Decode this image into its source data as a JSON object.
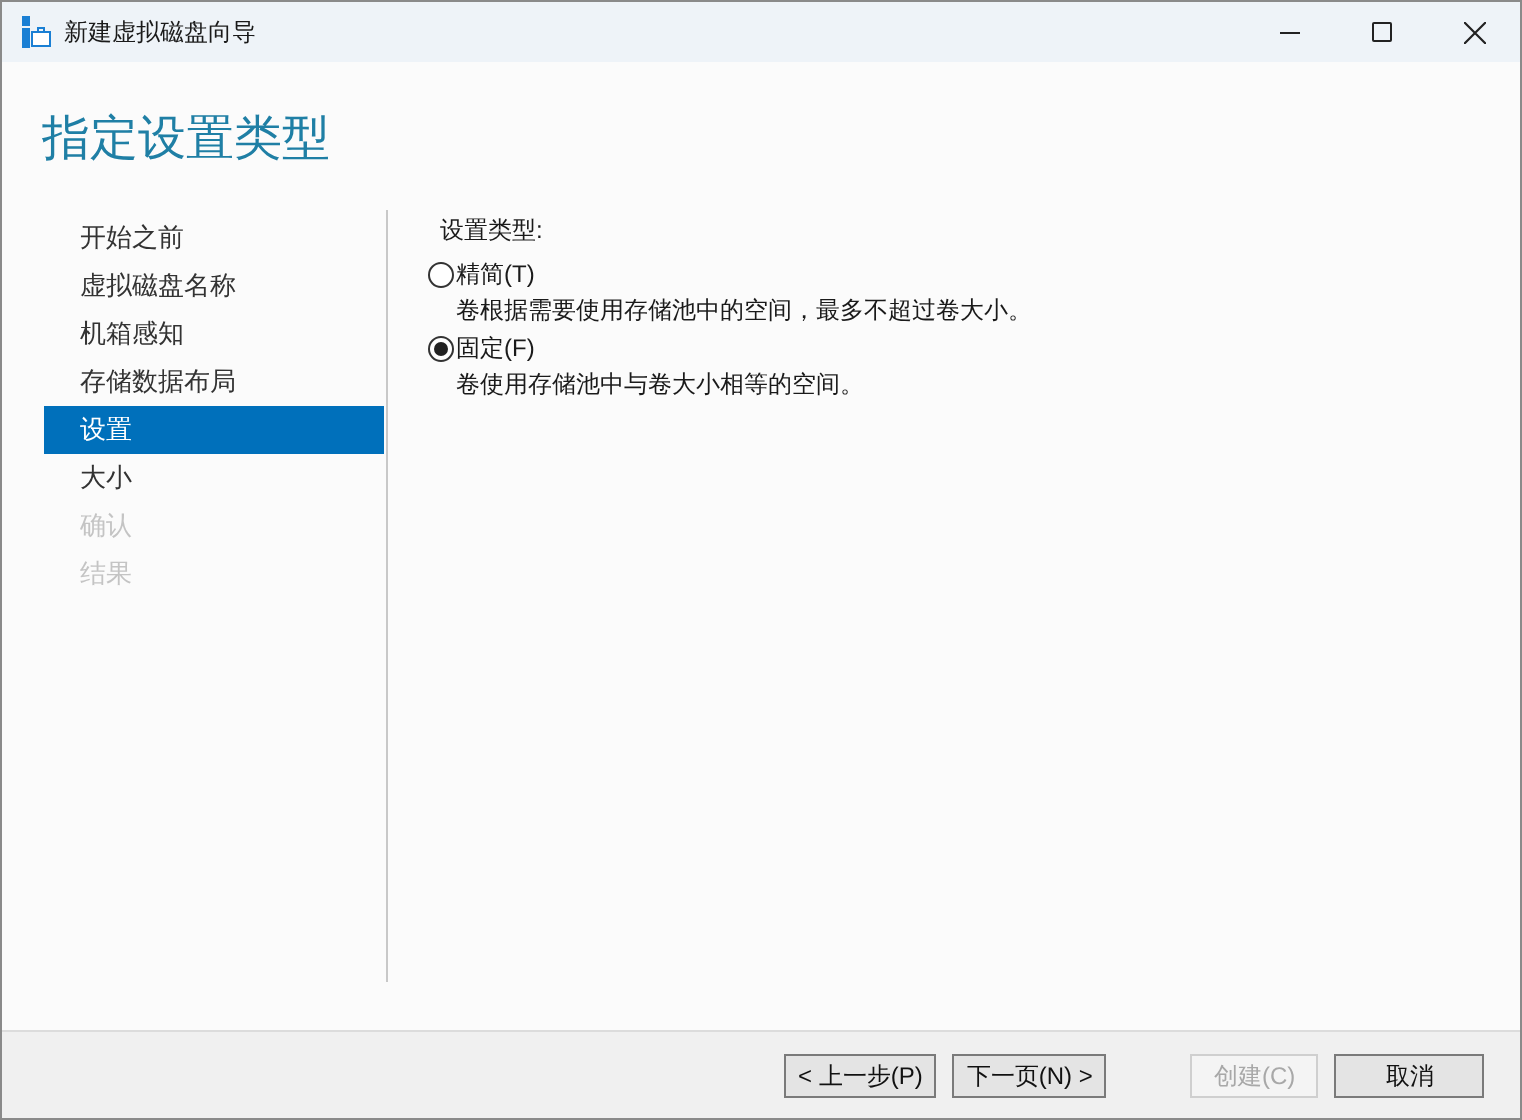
{
  "window": {
    "title": "新建虚拟磁盘向导"
  },
  "page_title": "指定设置类型",
  "steps": [
    {
      "label": "开始之前",
      "selected": false,
      "disabled": false
    },
    {
      "label": "虚拟磁盘名称",
      "selected": false,
      "disabled": false
    },
    {
      "label": "机箱感知",
      "selected": false,
      "disabled": false
    },
    {
      "label": "存储数据布局",
      "selected": false,
      "disabled": false
    },
    {
      "label": "设置",
      "selected": true,
      "disabled": false
    },
    {
      "label": "大小",
      "selected": false,
      "disabled": false
    },
    {
      "label": "确认",
      "selected": false,
      "disabled": true
    },
    {
      "label": "结果",
      "selected": false,
      "disabled": true
    }
  ],
  "group_label": "设置类型:",
  "options": [
    {
      "label": "精简(T)",
      "description": "卷根据需要使用存储池中的空间，最多不超过卷大小。",
      "selected": false
    },
    {
      "label": "固定(F)",
      "description": "卷使用存储池中与卷大小相等的空间。",
      "selected": true
    }
  ],
  "buttons": [
    {
      "label": "< 上一步(P)",
      "disabled": false
    },
    {
      "label": "下一页(N) >",
      "disabled": false
    },
    {
      "label": "创建(C)",
      "disabled": true
    },
    {
      "label": "取消",
      "disabled": false
    }
  ]
}
